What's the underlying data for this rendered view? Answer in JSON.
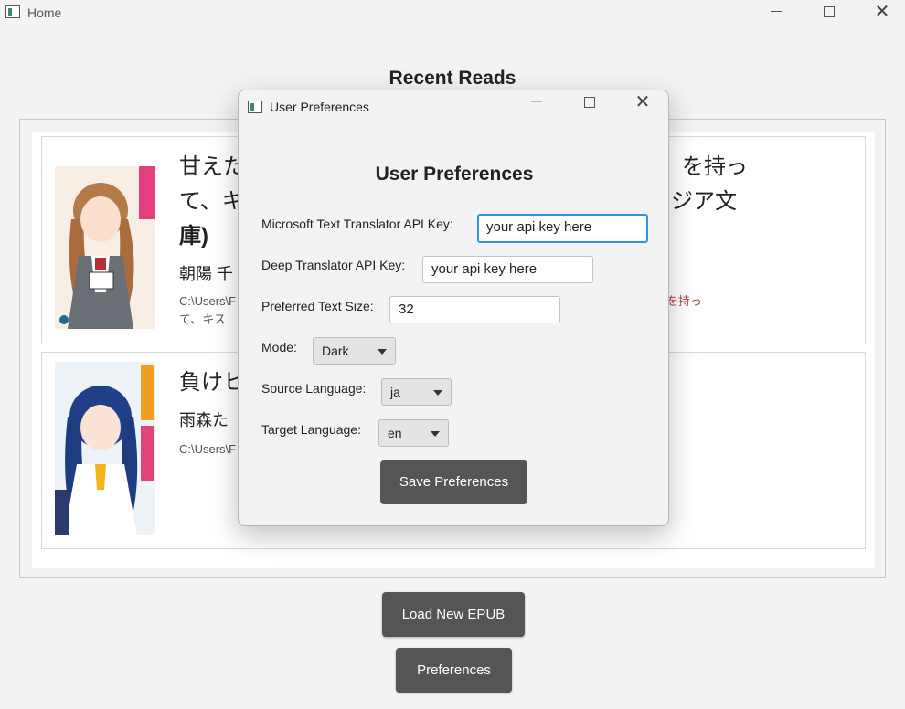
{
  "window": {
    "title": "Home"
  },
  "home": {
    "heading": "Recent Reads",
    "books": [
      {
        "title": "甘えたがりの後輩、キスを持って、キ… ジア文庫)",
        "title_line1": "甘えた",
        "title_line1_right": "を持っ",
        "title_line2": "て、キ",
        "title_line2_right": "ジア文",
        "title_line3": "庫)",
        "author": "朝陽 千",
        "path_line1": "C:\\Users\\F",
        "path_line1_right": "」を持っ",
        "path_line2": "て、キス"
      },
      {
        "title_line1": "負けヒ",
        "author": " 雨森た",
        "path_line1": "C:\\Users\\F"
      }
    ],
    "load_button": "Load New EPUB",
    "preferences_button": "Preferences"
  },
  "dialog": {
    "window_title": "User Preferences",
    "heading": "User Preferences",
    "ms_key_label": "Microsoft Text Translator API Key:",
    "ms_key_value": "your api key here",
    "deep_key_label": "Deep Translator API Key:",
    "deep_key_value": "your api key here",
    "text_size_label": "Preferred Text Size:",
    "text_size_value": "32",
    "mode_label": "Mode:",
    "mode_value": "Dark",
    "source_label": "Source Language:",
    "source_value": "ja",
    "target_label": "Target Language:",
    "target_value": "en",
    "save_button": "Save Preferences"
  },
  "colors": {
    "focus": "#2d98d8",
    "button": "#555555",
    "path_highlight": "#b04040"
  }
}
